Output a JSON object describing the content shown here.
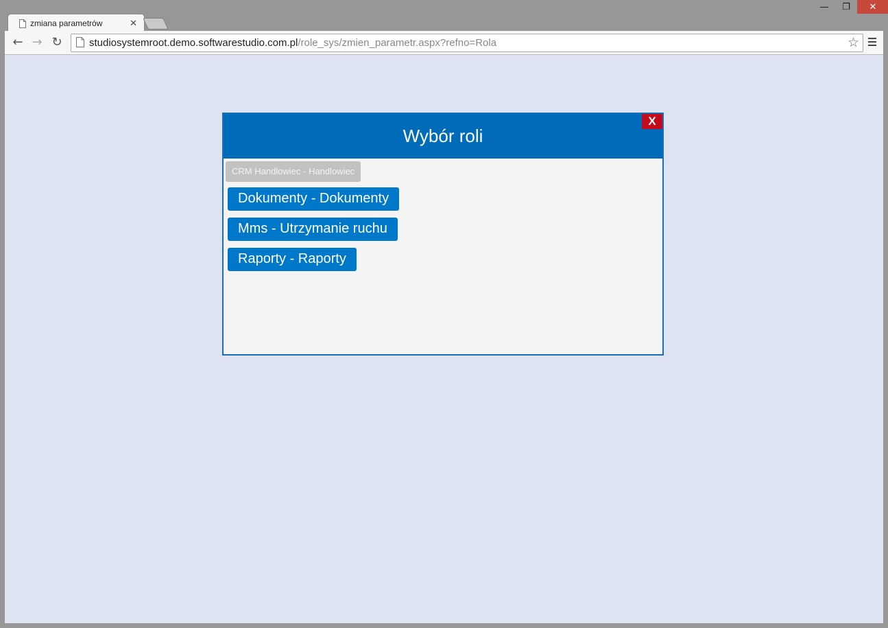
{
  "window": {
    "minimize_glyph": "—",
    "maximize_glyph": "❐",
    "close_glyph": "✕"
  },
  "tab": {
    "title": "zmiana parametrów",
    "close_glyph": "✕",
    "icon": "page-icon"
  },
  "toolbar": {
    "back_glyph": "←",
    "forward_glyph": "→",
    "reload_glyph": "↻",
    "url_host": "studiosystemroot.demo.softwarestudio.com.pl",
    "url_path": "/role_sys/zmien_parametr.aspx?refno=Rola",
    "star_glyph": "☆",
    "menu_icon": "hamburger-menu-icon"
  },
  "dialog": {
    "title": "Wybór roli",
    "close_label": "X",
    "disabled_role": "CRM Handlowiec - Handlowiec",
    "roles": [
      "Dokumenty - Dokumenty",
      "Mms - Utrzymanie ruchu",
      "Raporty - Raporty"
    ]
  },
  "colors": {
    "header_blue": "#006bb8",
    "button_blue": "#0078c9",
    "close_red": "#c40b1b",
    "page_background": "#dde3f1",
    "disabled_gray": "#c2c2c2"
  }
}
